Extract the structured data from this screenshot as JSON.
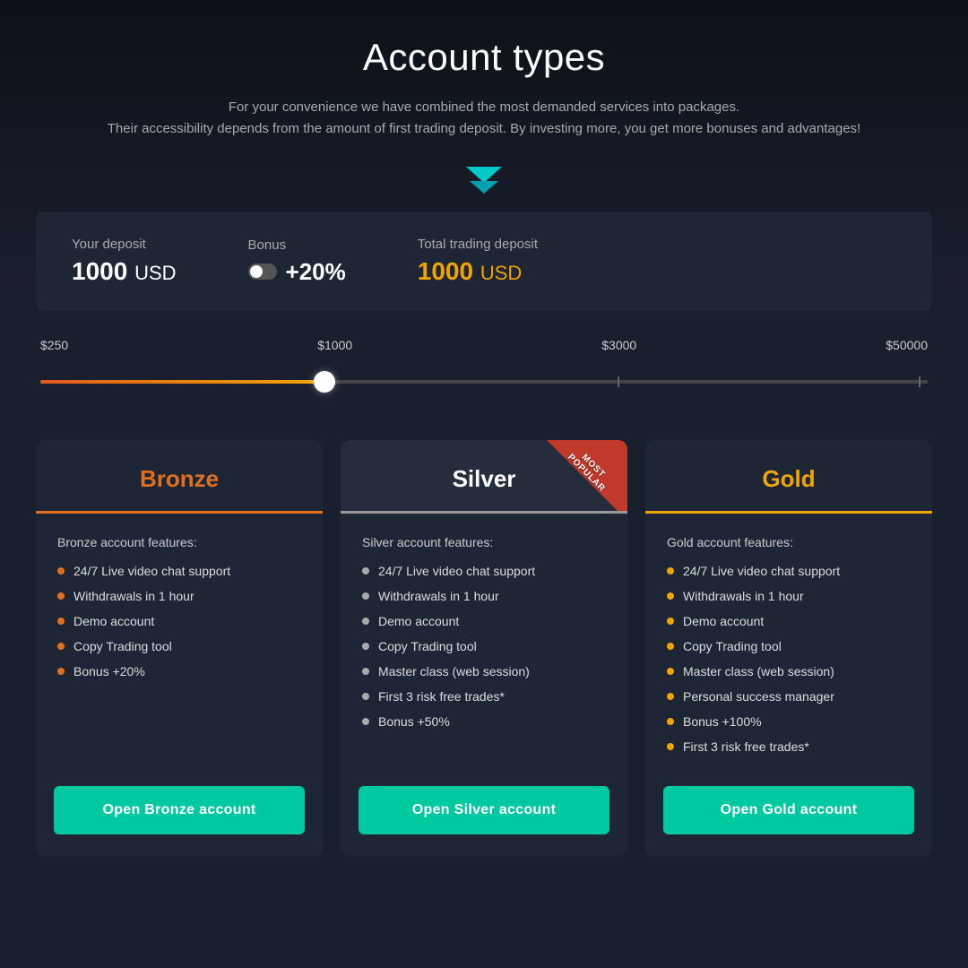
{
  "page": {
    "title": "Account types",
    "subtitle_line1": "For your convenience we have combined the most demanded services into packages.",
    "subtitle_line2": "Their accessibility depends from the amount of first trading deposit. By investing more, you get more bonuses and advantages!"
  },
  "deposit": {
    "your_deposit_label": "Your deposit",
    "your_deposit_amount": "1000",
    "your_deposit_currency": "USD",
    "bonus_label": "Bonus",
    "bonus_value": "+20%",
    "total_label": "Total trading deposit",
    "total_amount": "1000",
    "total_currency": "USD"
  },
  "slider": {
    "min_label": "$250",
    "mark1_label": "$1000",
    "mark2_label": "$3000",
    "max_label": "$50000",
    "current_value": 1000
  },
  "cards": [
    {
      "id": "bronze",
      "name": "Bronze",
      "features_title": "Bronze account features:",
      "features": [
        "24/7 Live video chat support",
        "Withdrawals in 1 hour",
        "Demo account",
        "Copy Trading tool",
        "Bonus +20%"
      ],
      "button_label": "Open Bronze account"
    },
    {
      "id": "silver",
      "name": "Silver",
      "badge": "MOST POPULAR",
      "features_title": "Silver account features:",
      "features": [
        "24/7 Live video chat support",
        "Withdrawals in 1 hour",
        "Demo account",
        "Copy Trading tool",
        "Master class (web session)",
        "First 3 risk free trades*",
        "Bonus +50%"
      ],
      "button_label": "Open Silver account"
    },
    {
      "id": "gold",
      "name": "Gold",
      "features_title": "Gold account features:",
      "features": [
        "24/7 Live video chat support",
        "Withdrawals in 1 hour",
        "Demo account",
        "Copy Trading tool",
        "Master class (web session)",
        "Personal success manager",
        "Bonus +100%",
        "First 3 risk free trades*"
      ],
      "button_label": "Open Gold account"
    }
  ]
}
